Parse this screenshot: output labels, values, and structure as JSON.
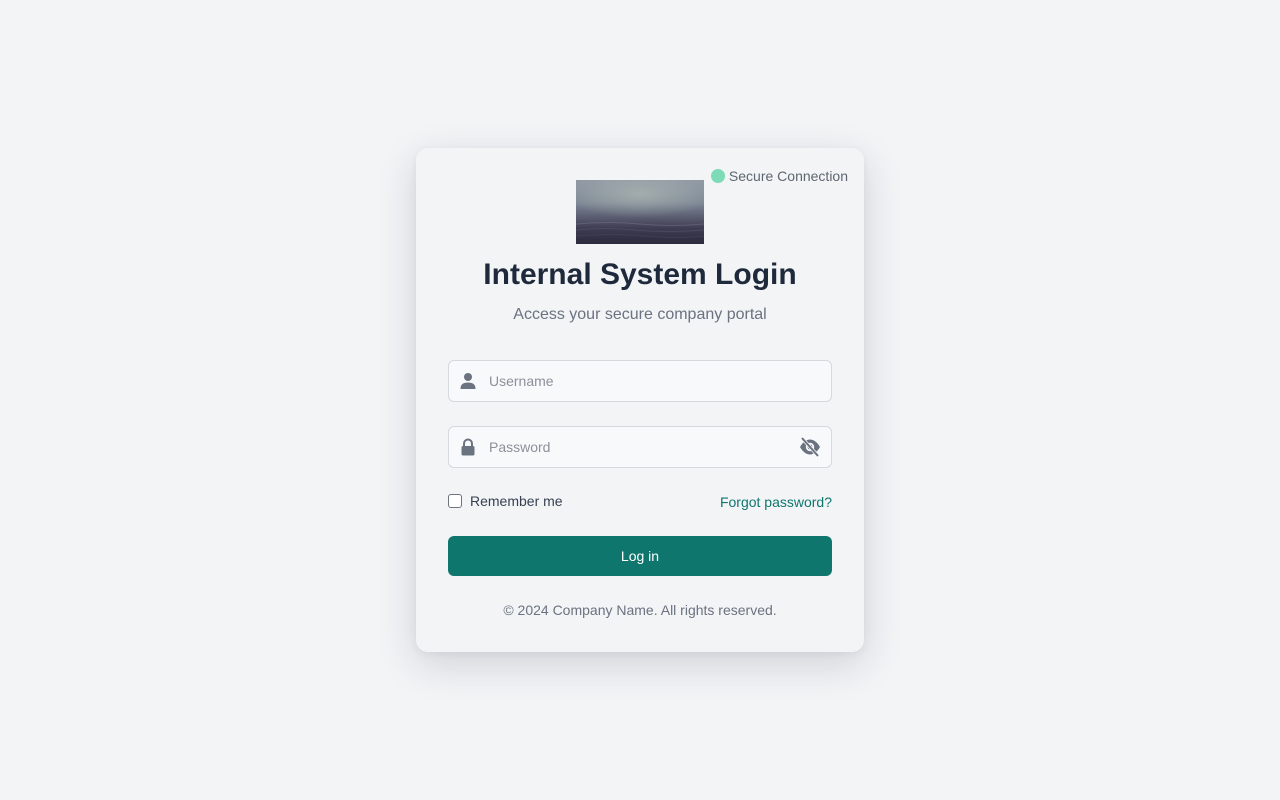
{
  "status": {
    "secure_label": "Secure Connection",
    "secure_color": "#7ddbb8"
  },
  "header": {
    "logo_icon": "foggy-sea-image",
    "title": "Internal System Login",
    "subtitle": "Access your secure company portal"
  },
  "form": {
    "username": {
      "placeholder": "Username",
      "value": "",
      "icon": "user-icon"
    },
    "password": {
      "placeholder": "Password",
      "value": "",
      "icon": "lock-icon",
      "toggle_icon": "eye-off-icon"
    },
    "remember_label": "Remember me",
    "remember_checked": false,
    "forgot_label": "Forgot password?",
    "submit_label": "Log in"
  },
  "footer": {
    "copyright": "© 2024 Company Name. All rights reserved."
  },
  "colors": {
    "accent": "#0f766e",
    "background": "#f2f4f6",
    "title": "#1e293b"
  }
}
